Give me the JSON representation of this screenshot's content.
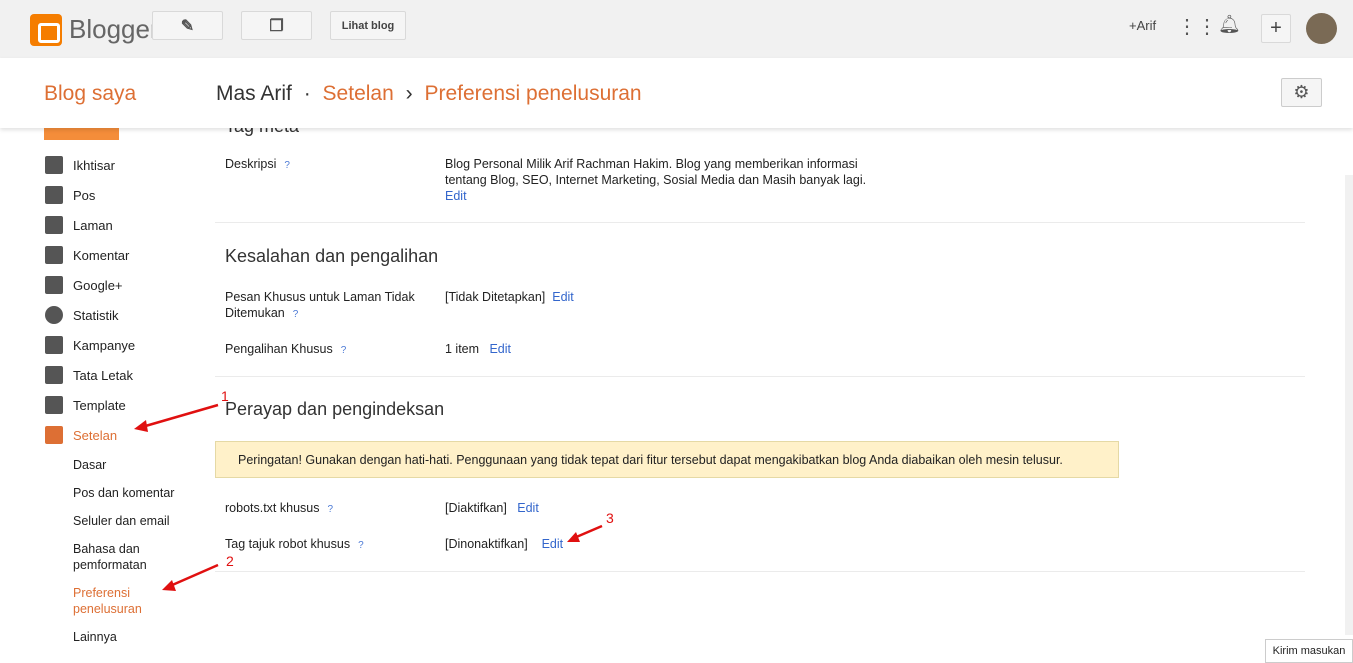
{
  "topbar": {
    "brand": "Blogger",
    "view_blog": "Lihat blog",
    "user": "+Arif",
    "icons": [
      "pencil-icon",
      "posts-icon",
      "apps-grid-icon",
      "bell-icon",
      "plus-icon"
    ]
  },
  "header": {
    "my_blogs": "Blog saya",
    "blog_name": "Mas Arif",
    "sep": "·",
    "settings": "Setelan",
    "arrow": "›",
    "current": "Preferensi penelusuran"
  },
  "sidebar": {
    "items": [
      {
        "label": "Ikhtisar",
        "icon": "home-icon"
      },
      {
        "label": "Pos",
        "icon": "posts-icon"
      },
      {
        "label": "Laman",
        "icon": "page-icon"
      },
      {
        "label": "Komentar",
        "icon": "comment-icon"
      },
      {
        "label": "Google+",
        "icon": "google-plus-icon"
      },
      {
        "label": "Statistik",
        "icon": "pie-chart-icon"
      },
      {
        "label": "Kampanye",
        "icon": "adwords-icon"
      },
      {
        "label": "Tata Letak",
        "icon": "layout-icon"
      },
      {
        "label": "Template",
        "icon": "paint-roller-icon"
      },
      {
        "label": "Setelan",
        "icon": "wrench-icon"
      }
    ],
    "subitems": [
      "Dasar",
      "Pos dan komentar",
      "Seluler dan email",
      "Bahasa dan pemformatan",
      "Preferensi penelusuran",
      "Lainnya"
    ]
  },
  "meta": {
    "title": "Tag meta",
    "desc_label": "Deskripsi",
    "help": "?",
    "desc_value": "Blog Personal Milik Arif Rachman Hakim. Blog yang memberikan informasi tentang Blog, SEO, Internet Marketing, Sosial Media dan Masih banyak lagi.",
    "edit": "Edit"
  },
  "errors": {
    "title": "Kesalahan dan pengalihan",
    "notfound_label": "Pesan Khusus untuk Laman Tidak Ditemukan",
    "notfound_value": "[Tidak Ditetapkan]",
    "redirect_label": "Pengalihan Khusus",
    "redirect_value": "1 item"
  },
  "crawl": {
    "title": "Perayap dan pengindeksan",
    "warning": "Peringatan! Gunakan dengan hati-hati. Penggunaan yang tidak tepat dari fitur tersebut dapat mengakibatkan blog Anda diabaikan oleh mesin telusur.",
    "robots_label": "robots.txt khusus",
    "robots_value": "[Diaktifkan]",
    "tag_label": "Tag tajuk robot khusus",
    "tag_value": "[Dinonaktifkan]"
  },
  "annotations": [
    "1",
    "2",
    "3"
  ],
  "feedback": "Kirim masukan"
}
